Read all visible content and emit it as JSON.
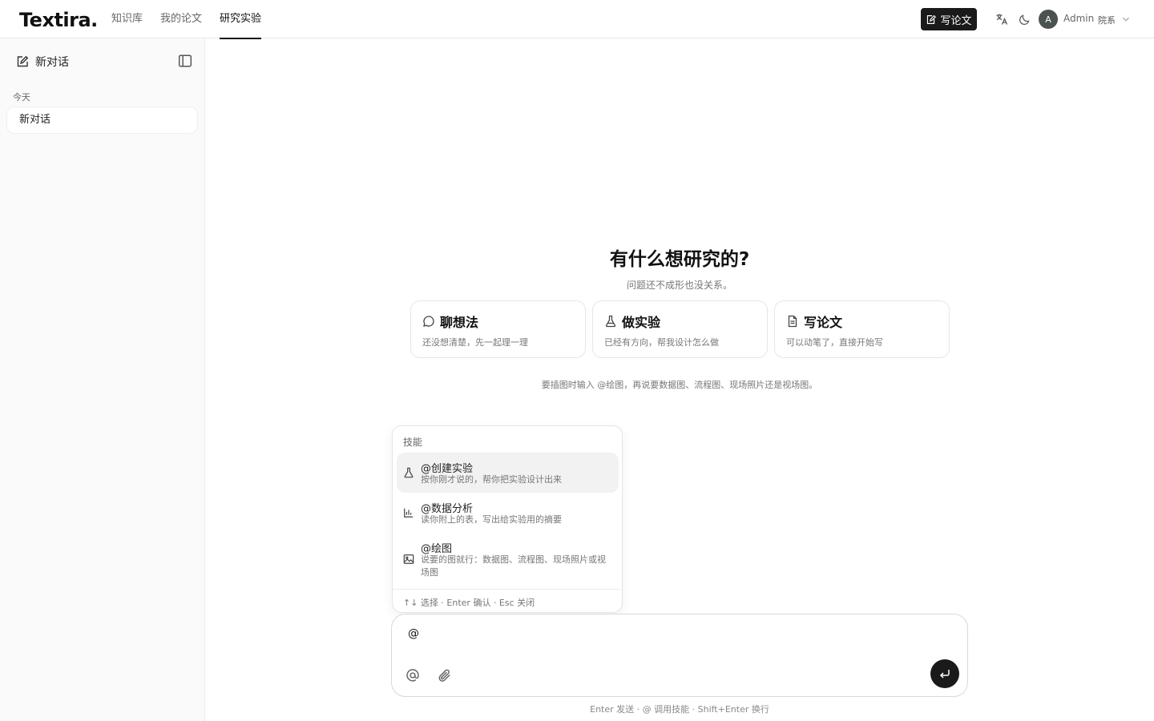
{
  "app": {
    "logo": "Textira",
    "logo_dot": "."
  },
  "nav": {
    "items": [
      {
        "label": "知识库",
        "active": false
      },
      {
        "label": "我的论文",
        "active": false
      },
      {
        "label": "研究实验",
        "active": true
      }
    ]
  },
  "header": {
    "write_button": "写论文",
    "user": {
      "initial": "A",
      "name": "Admin",
      "dept": "院系"
    },
    "icons": [
      "translate-icon",
      "moon-icon",
      "chevron-down-icon"
    ]
  },
  "sidebar": {
    "new_chat": "新对话",
    "section_today": "今天",
    "conversations": [
      {
        "title": "新对话"
      }
    ]
  },
  "main": {
    "title": "有什么想研究的?",
    "subtitle": "问题还不成形也没关系。",
    "cards": [
      {
        "icon": "chat-bubble-icon",
        "title": "聊想法",
        "desc": "还没想清楚，先一起理一理"
      },
      {
        "icon": "flask-icon",
        "title": "做实验",
        "desc": "已经有方向，帮我设计怎么做"
      },
      {
        "icon": "document-icon",
        "title": "写论文",
        "desc": "可以动笔了，直接开始写"
      }
    ],
    "hint": "要插图时输入 @绘图，再说要数据图、流程图、现场照片还是视场图。"
  },
  "skills_popup": {
    "title": "技能",
    "items": [
      {
        "icon": "flask-icon",
        "name": "@创建实验",
        "desc": "按你刚才说的，帮你把实验设计出来",
        "active": true
      },
      {
        "icon": "bar-chart-icon",
        "name": "@数据分析",
        "desc": "读你附上的表，写出给实验用的摘要",
        "active": false
      },
      {
        "icon": "image-icon",
        "name": "@绘图",
        "desc": "说要的图就行：数据图、流程图、现场照片或视场图",
        "active": false
      }
    ],
    "footer": "↑↓ 选择 · Enter 确认 · Esc 关闭"
  },
  "composer": {
    "value": "@",
    "hint": "Enter 发送 · @ 调用技能 · Shift+Enter 换行"
  },
  "colors": {
    "accent": "#1a1a1a",
    "sidebar_bg": "#fafafa",
    "avatar_bg": "#4a5350"
  }
}
